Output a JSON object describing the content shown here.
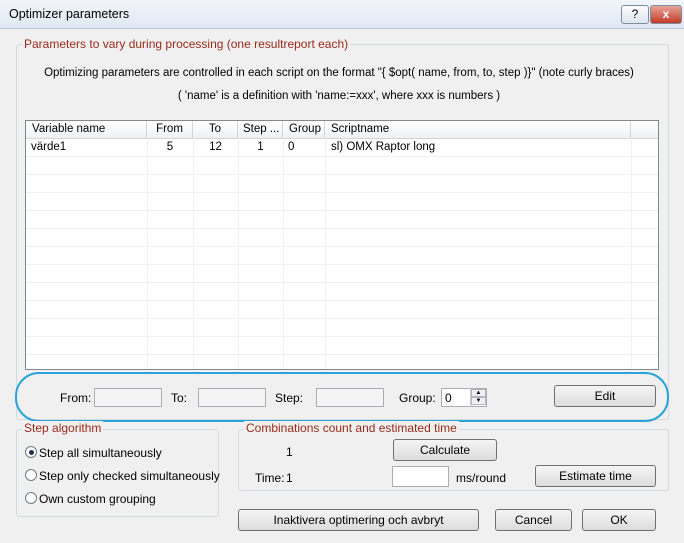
{
  "window": {
    "title": "Optimizer parameters",
    "help_label": "?",
    "close_label": "x"
  },
  "params_group": {
    "legend": "Parameters to vary during processing (one resultreport each)",
    "info_line1": "Optimizing parameters are controlled in each script on the format \"{ $opt( name, from, to, step )}\" (note curly braces)",
    "info_line2": "( 'name' is a definition with 'name:=xxx', where xxx is numbers )"
  },
  "table": {
    "columns": [
      "Variable name",
      "From",
      "To",
      "Step ...",
      "Group",
      "Scriptname"
    ],
    "rows": [
      [
        "värde1",
        "5",
        "12",
        "1",
        "0",
        "sl) OMX Raptor long"
      ]
    ]
  },
  "edit_row": {
    "from_label": "From:",
    "from_value": "",
    "to_label": "To:",
    "to_value": "",
    "step_label": "Step:",
    "step_value": "",
    "group_label": "Group:",
    "group_value": "0",
    "edit_button": "Edit"
  },
  "step_algorithm": {
    "legend": "Step algorithm",
    "options": [
      "Step all simultaneously",
      "Step only checked simultaneously",
      "Own custom grouping"
    ],
    "selected": 0
  },
  "combinations": {
    "legend": "Combinations count and estimated time",
    "count": "1",
    "calculate_button": "Calculate",
    "time_label": "Time:",
    "time_value": "1",
    "ms_value": "",
    "ms_unit": "ms/round",
    "estimate_button": "Estimate time"
  },
  "footer": {
    "abort_button": "Inaktivera optimering och avbryt",
    "cancel_button": "Cancel",
    "ok_button": "OK"
  }
}
